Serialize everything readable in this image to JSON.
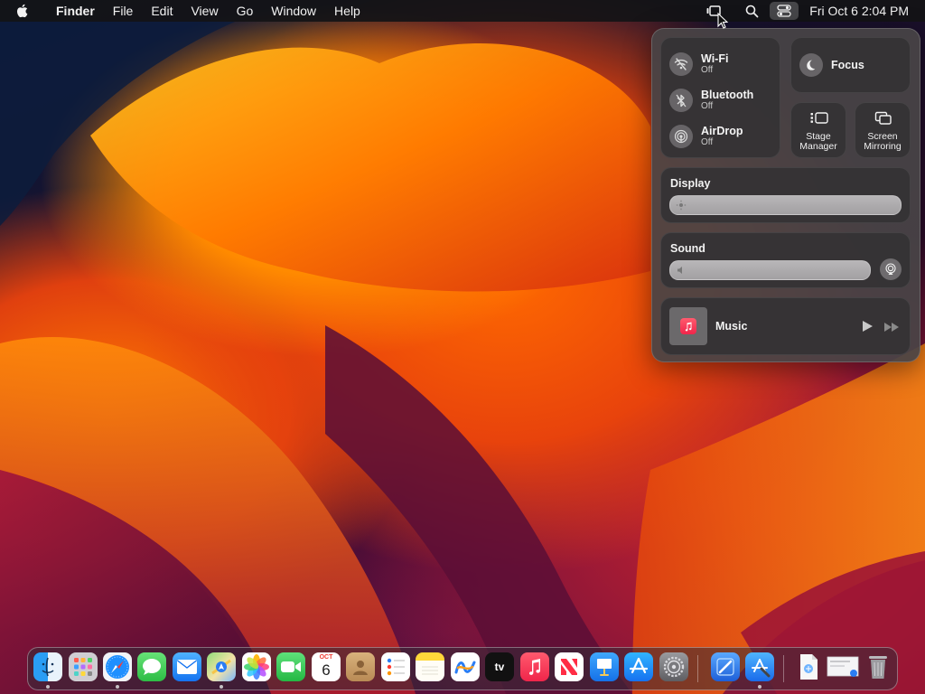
{
  "menubar": {
    "app_name": "Finder",
    "items": [
      "File",
      "Edit",
      "View",
      "Go",
      "Window",
      "Help"
    ],
    "clock": "Fri Oct 6  2:04 PM",
    "status_icons": [
      "stage-manager-icon",
      "spotlight-search-icon",
      "control-center-icon"
    ]
  },
  "control_center": {
    "connectivity": [
      {
        "name": "Wi-Fi",
        "status": "Off",
        "icon": "wifi-off-icon"
      },
      {
        "name": "Bluetooth",
        "status": "Off",
        "icon": "bluetooth-off-icon"
      },
      {
        "name": "AirDrop",
        "status": "Off",
        "icon": "airdrop-icon"
      }
    ],
    "focus": {
      "label": "Focus",
      "icon": "moon-icon"
    },
    "stage_manager": {
      "label_line1": "Stage",
      "label_line2": "Manager"
    },
    "screen_mirroring": {
      "label_line1": "Screen",
      "label_line2": "Mirroring"
    },
    "display": {
      "title": "Display"
    },
    "sound": {
      "title": "Sound"
    },
    "now_playing": {
      "title": "Music"
    }
  },
  "dock": {
    "apps": [
      {
        "name": "Finder",
        "icon": "finder-icon",
        "running": true
      },
      {
        "name": "Launchpad",
        "icon": "launchpad-icon",
        "running": false
      },
      {
        "name": "Safari",
        "icon": "safari-icon",
        "running": true
      },
      {
        "name": "Messages",
        "icon": "messages-icon",
        "running": false
      },
      {
        "name": "Mail",
        "icon": "mail-icon",
        "running": false
      },
      {
        "name": "Maps",
        "icon": "maps-icon",
        "running": true
      },
      {
        "name": "Photos",
        "icon": "photos-icon",
        "running": false
      },
      {
        "name": "FaceTime",
        "icon": "facetime-icon",
        "running": false
      },
      {
        "name": "Calendar",
        "icon": "calendar-icon",
        "running": false,
        "month": "OCT",
        "day": "6"
      },
      {
        "name": "Contacts",
        "icon": "contacts-icon",
        "running": false
      },
      {
        "name": "Reminders",
        "icon": "reminders-icon",
        "running": false
      },
      {
        "name": "Notes",
        "icon": "notes-icon",
        "running": false
      },
      {
        "name": "Freeform",
        "icon": "freeform-icon",
        "running": false
      },
      {
        "name": "TV",
        "icon": "tv-icon",
        "running": false,
        "label": "tv"
      },
      {
        "name": "Music",
        "icon": "music-icon",
        "running": false
      },
      {
        "name": "News",
        "icon": "news-icon",
        "running": false
      },
      {
        "name": "Keynote",
        "icon": "keynote-icon",
        "running": false
      },
      {
        "name": "App Store",
        "icon": "app-store-icon",
        "running": false
      },
      {
        "name": "System Settings",
        "icon": "system-settings-icon",
        "running": false
      },
      {
        "name": "Xcode",
        "icon": "xcode-icon",
        "running": false
      },
      {
        "name": "Xcode Preview",
        "icon": "xcode-blue-icon",
        "running": true
      },
      {
        "name": "Document",
        "icon": "document-icon",
        "running": false
      },
      {
        "name": "Screenshot",
        "icon": "screenshot-thumbnail-icon",
        "running": false
      },
      {
        "name": "Trash",
        "icon": "trash-icon",
        "running": false
      }
    ]
  },
  "colors": {
    "menubar_bg": "#141416",
    "panel_bg": "#484446",
    "tile_bg": "#343234",
    "music_red": "#f0254a"
  }
}
